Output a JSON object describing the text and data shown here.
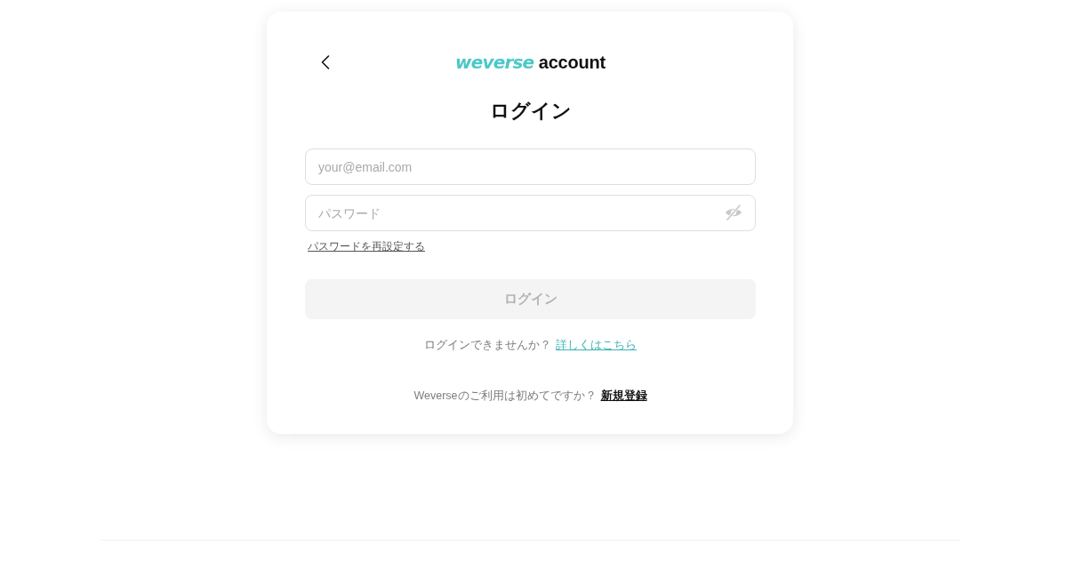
{
  "logo": {
    "brand": "weverse",
    "suffix": "account"
  },
  "title": "ログイン",
  "fields": [
    {
      "kind": "email",
      "placeholder": "your@email.com"
    },
    {
      "kind": "password",
      "placeholder": "パスワード",
      "password_visible": false
    }
  ],
  "reset_link": "パスワードを再設定する",
  "login_button": {
    "label": "ログイン",
    "disabled": true
  },
  "help": {
    "text": "ログインできませんか？",
    "link": "詳しくはこちら"
  },
  "signup": {
    "text": "Weverseのご利用は初めてですか？",
    "link": "新規登録"
  }
}
